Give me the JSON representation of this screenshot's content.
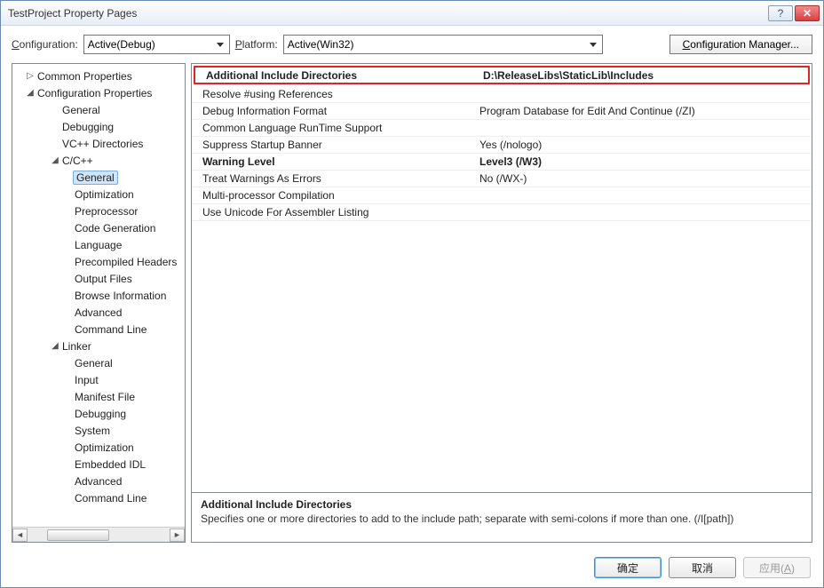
{
  "window": {
    "title": "TestProject Property Pages"
  },
  "toolbar": {
    "configuration_label": "Configuration:",
    "configuration_value": "Active(Debug)",
    "platform_label": "Platform:",
    "platform_value": "Active(Win32)",
    "config_manager_label": "Configuration Manager..."
  },
  "titlebar_icons": {
    "help": "?",
    "close": "✕"
  },
  "tree": {
    "items": [
      {
        "label": "Common Properties",
        "indent": 1,
        "twisty": "▷"
      },
      {
        "label": "Configuration Properties",
        "indent": 1,
        "twisty": "◢"
      },
      {
        "label": "General",
        "indent": 3
      },
      {
        "label": "Debugging",
        "indent": 3
      },
      {
        "label": "VC++ Directories",
        "indent": 3
      },
      {
        "label": "C/C++",
        "indent": 3,
        "twisty": "◢"
      },
      {
        "label": "General",
        "indent": 4,
        "selected": true
      },
      {
        "label": "Optimization",
        "indent": 4
      },
      {
        "label": "Preprocessor",
        "indent": 4
      },
      {
        "label": "Code Generation",
        "indent": 4
      },
      {
        "label": "Language",
        "indent": 4
      },
      {
        "label": "Precompiled Headers",
        "indent": 4
      },
      {
        "label": "Output Files",
        "indent": 4
      },
      {
        "label": "Browse Information",
        "indent": 4
      },
      {
        "label": "Advanced",
        "indent": 4
      },
      {
        "label": "Command Line",
        "indent": 4
      },
      {
        "label": "Linker",
        "indent": 3,
        "twisty": "◢"
      },
      {
        "label": "General",
        "indent": 4
      },
      {
        "label": "Input",
        "indent": 4
      },
      {
        "label": "Manifest File",
        "indent": 4
      },
      {
        "label": "Debugging",
        "indent": 4
      },
      {
        "label": "System",
        "indent": 4
      },
      {
        "label": "Optimization",
        "indent": 4
      },
      {
        "label": "Embedded IDL",
        "indent": 4
      },
      {
        "label": "Advanced",
        "indent": 4
      },
      {
        "label": "Command Line",
        "indent": 4
      }
    ]
  },
  "grid": {
    "rows": [
      {
        "name": "Additional Include Directories",
        "value": "D:\\ReleaseLibs\\StaticLib\\Includes",
        "bold": true,
        "highlight": true
      },
      {
        "name": "Resolve #using References",
        "value": ""
      },
      {
        "name": "Debug Information Format",
        "value": "Program Database for Edit And Continue (/ZI)"
      },
      {
        "name": "Common Language RunTime Support",
        "value": ""
      },
      {
        "name": "Suppress Startup Banner",
        "value": "Yes (/nologo)"
      },
      {
        "name": "Warning Level",
        "value": "Level3 (/W3)",
        "bold": true
      },
      {
        "name": "Treat Warnings As Errors",
        "value": "No (/WX-)"
      },
      {
        "name": "Multi-processor Compilation",
        "value": ""
      },
      {
        "name": "Use Unicode For Assembler Listing",
        "value": ""
      }
    ]
  },
  "description": {
    "title": "Additional Include Directories",
    "body": "Specifies one or more directories to add to the include path; separate with semi-colons if more than one.     (/I[path])"
  },
  "buttons": {
    "ok": "确定",
    "cancel": "取消",
    "apply": "应用(A)"
  }
}
